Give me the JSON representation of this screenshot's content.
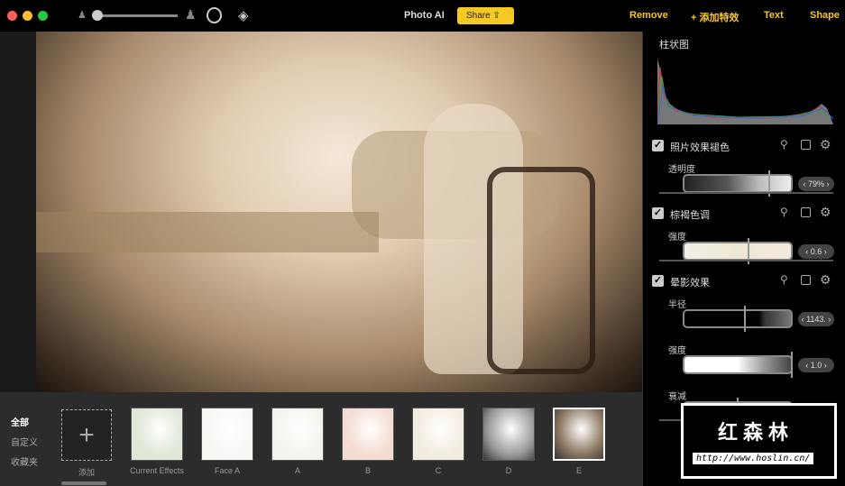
{
  "window": {
    "title": "Photo AI",
    "share_label": "Share",
    "colors": {
      "accent": "#f5c825",
      "close": "#ff5f57",
      "min": "#febc2e",
      "max": "#28c840"
    }
  },
  "toolbar": {
    "remove": "Remove",
    "add_effect": "+ 添加特效",
    "text": "Text",
    "shape": "Shape"
  },
  "categories": [
    "全部",
    "自定义",
    "收藏夹"
  ],
  "add_label": "添加",
  "presets": [
    {
      "label": "Current Effects"
    },
    {
      "label": "Face A"
    },
    {
      "label": "A"
    },
    {
      "label": "B"
    },
    {
      "label": "C"
    },
    {
      "label": "D"
    },
    {
      "label": "E",
      "selected": true
    }
  ],
  "panel": {
    "histogram_title": "柱状图",
    "effects": [
      {
        "name": "照片效果褪色",
        "params": [
          {
            "label": "透明度",
            "value": "79%",
            "fraction": 0.79
          }
        ]
      },
      {
        "name": "棕褐色调",
        "params": [
          {
            "label": "强度",
            "value": "0.6",
            "fraction": 0.6
          }
        ]
      },
      {
        "name": "晕影效果",
        "params": [
          {
            "label": "半径",
            "value": "1143.",
            "fraction": 0.57
          },
          {
            "label": "强度",
            "value": "1.0",
            "fraction": 1.0
          },
          {
            "label": "衰减",
            "value": "0.5",
            "fraction": 0.5
          }
        ]
      }
    ]
  },
  "watermark": {
    "title": "红森林",
    "url": "http://www.hoslin.cn/"
  }
}
